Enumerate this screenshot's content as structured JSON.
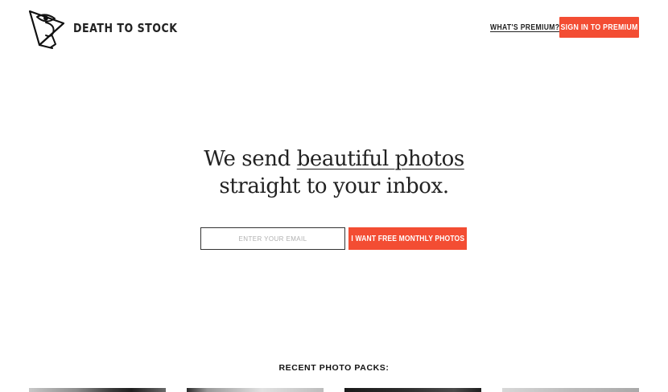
{
  "header": {
    "brand": "DEATH TO STOCK",
    "nav_link": "WHAT'S PREMIUM?",
    "signin_label": "SIGN IN TO PREMIUM",
    "logo_icon": "eye-flag-logo-icon"
  },
  "hero": {
    "line1_prefix": "We send ",
    "line1_link": "beautiful photos",
    "line2": "straight to your inbox."
  },
  "signup": {
    "email_placeholder": "ENTER YOUR EMAIL",
    "email_value": "",
    "submit_label": "I WANT FREE MONTHLY PHOTOS"
  },
  "recent": {
    "heading": "RECENT PHOTO PACKS:"
  },
  "colors": {
    "accent": "#f34d33",
    "text": "#222222",
    "background": "#ffffff"
  }
}
